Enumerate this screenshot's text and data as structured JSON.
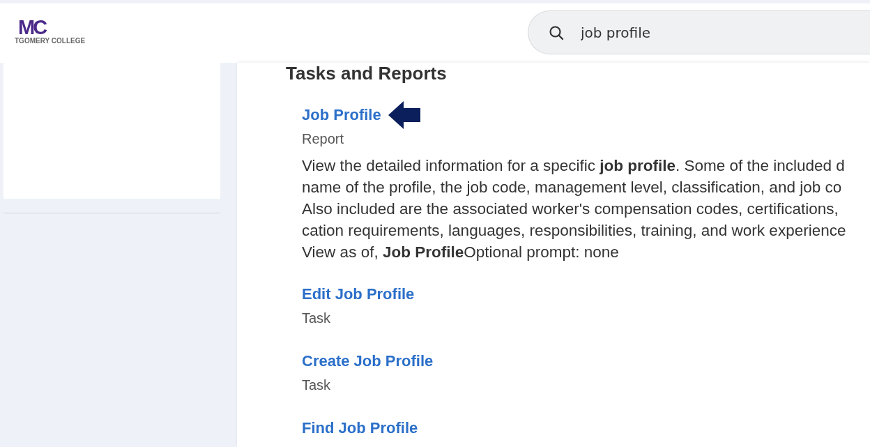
{
  "logo": {
    "mark": "MC",
    "caption": "TGOMERY COLLEGE"
  },
  "search": {
    "value": "job profile"
  },
  "section": {
    "title": "Tasks and Reports"
  },
  "results": [
    {
      "title": "Job Profile",
      "type": "Report",
      "pointed": true,
      "description": [
        "View the detailed information for a specific **job profile**. Some of the included d",
        "name of the profile, the job code, management level, classification, and job co",
        "Also included are the associated worker's compensation codes, certifications,",
        "cation requirements, languages, responsibilities, training, and work experience",
        "View as of, **Job Profile**Optional prompt: none"
      ]
    },
    {
      "title": "Edit Job Profile",
      "type": "Task",
      "pointed": false
    },
    {
      "title": "Create Job Profile",
      "type": "Task",
      "pointed": false
    },
    {
      "title": "Find Job Profile",
      "pointed": false
    }
  ]
}
